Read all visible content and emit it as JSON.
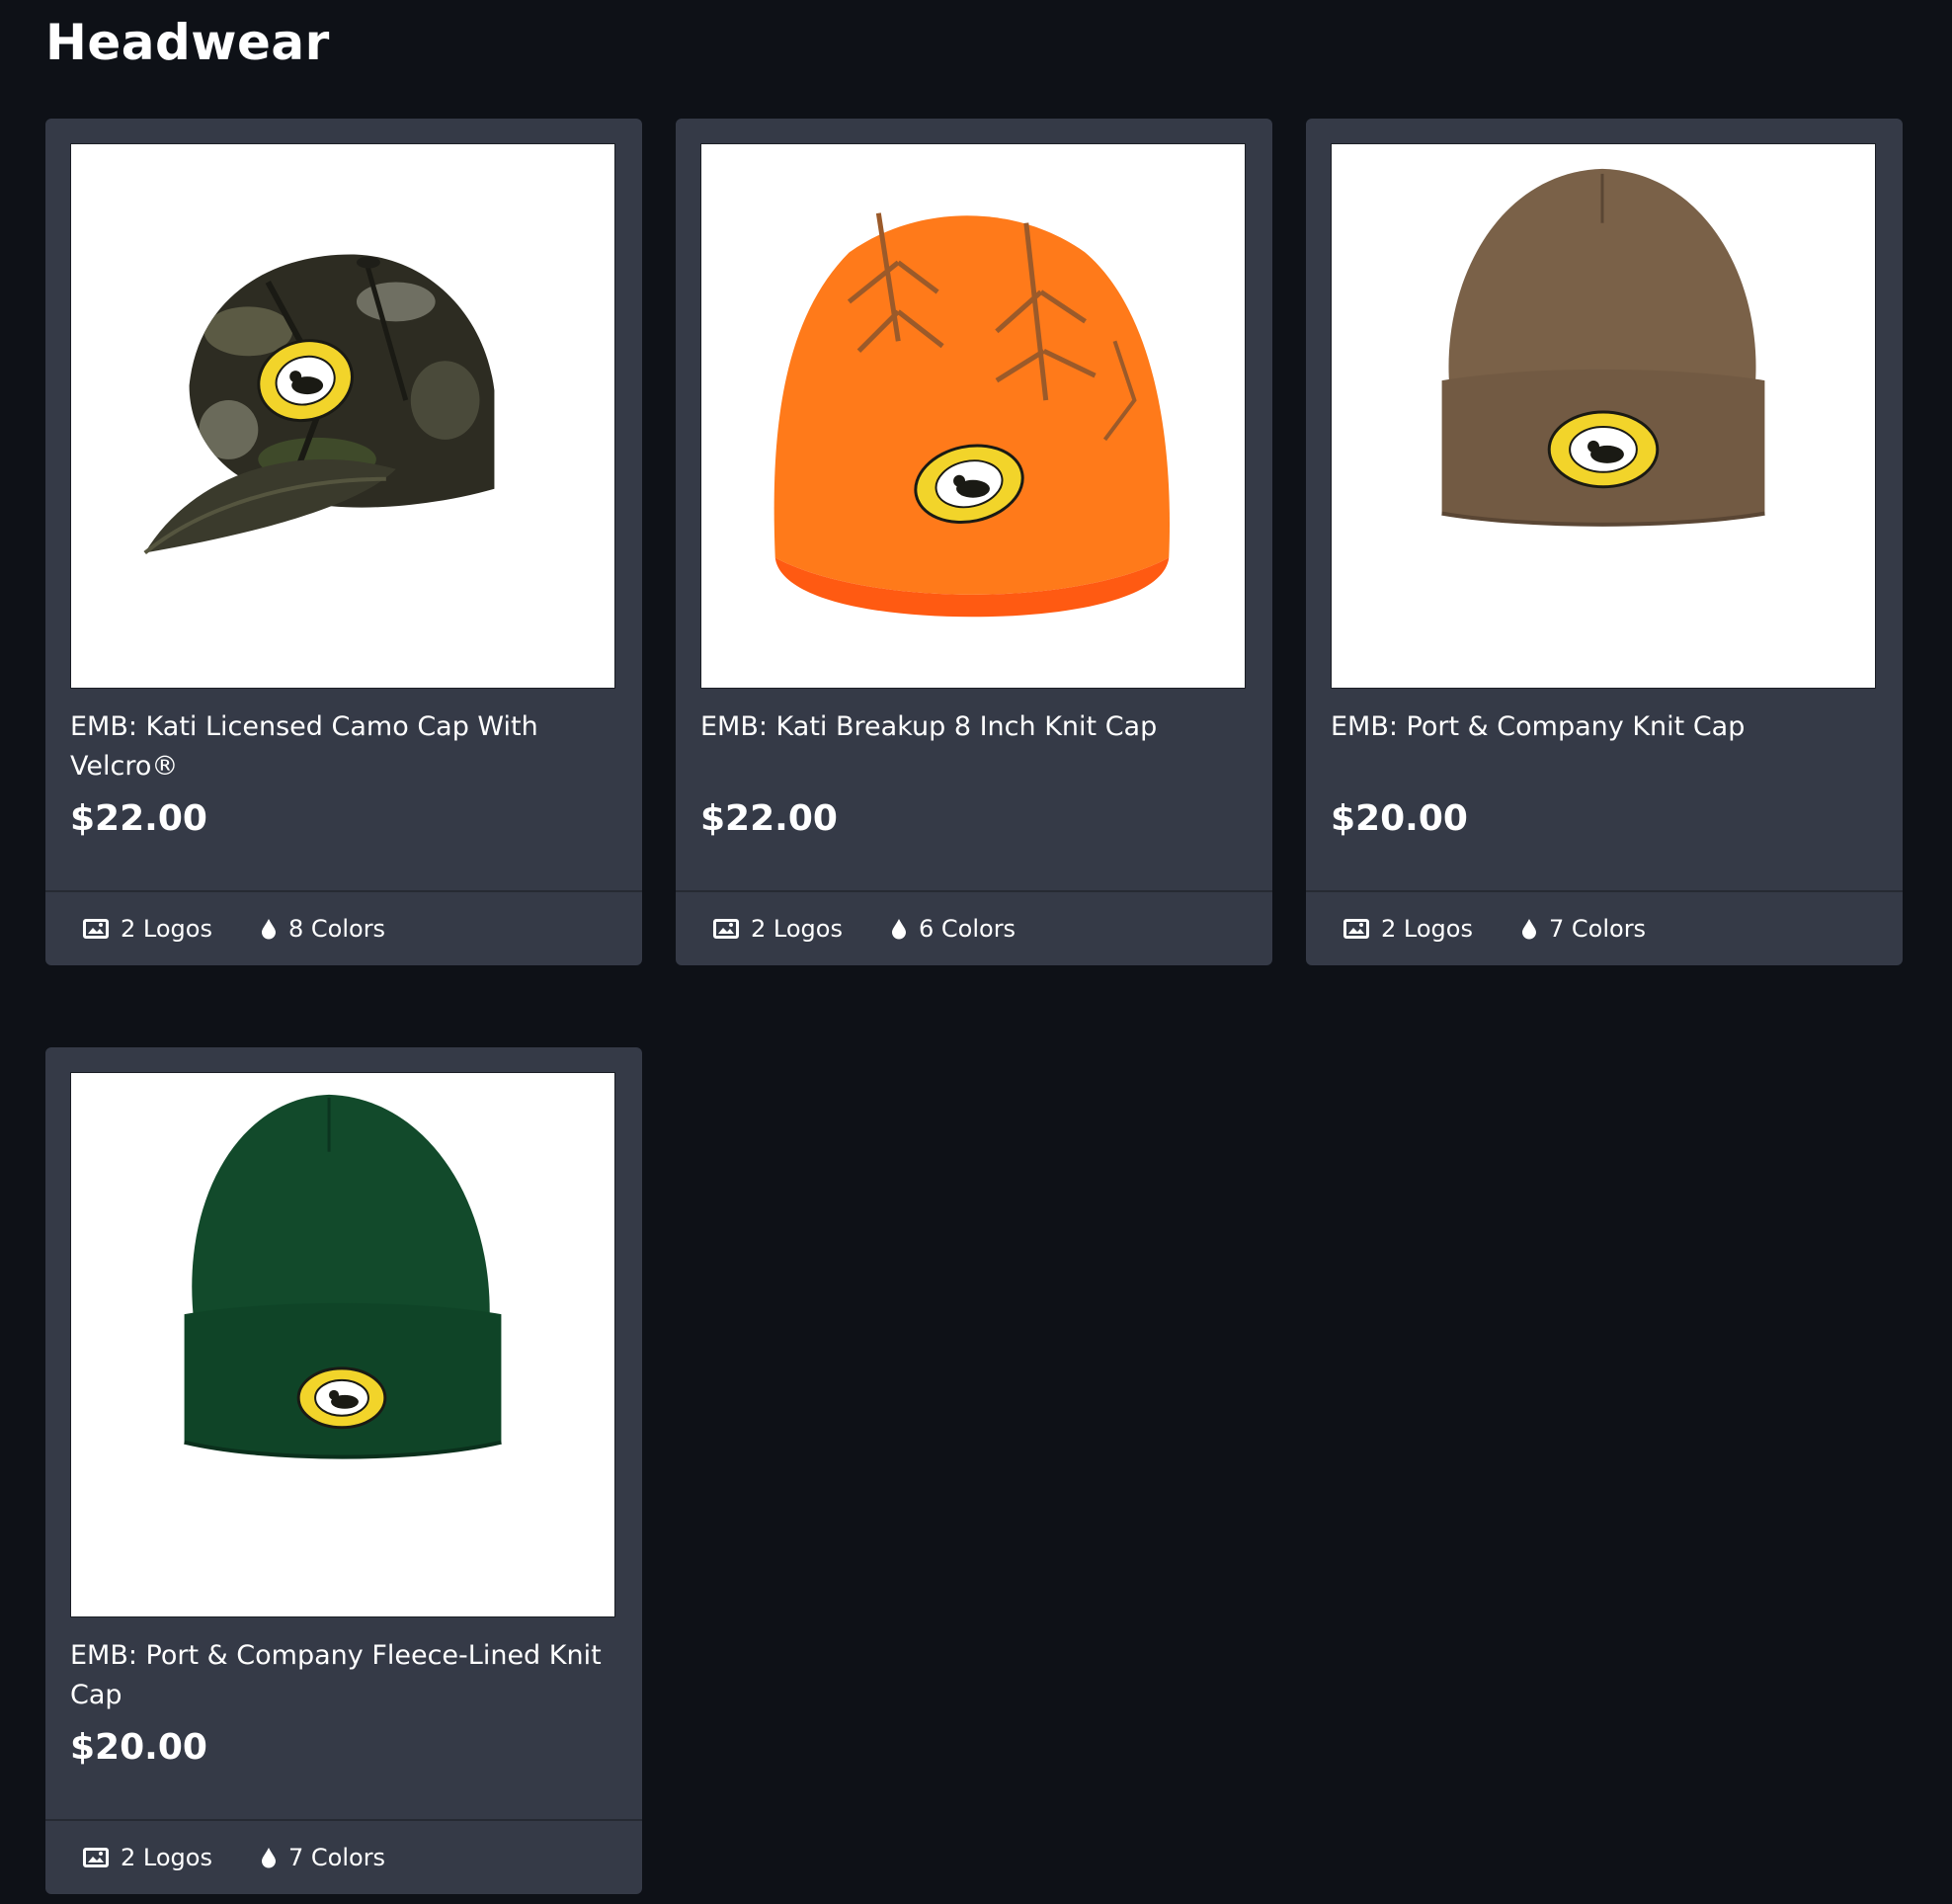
{
  "page": {
    "title": "Headwear",
    "background": "#0e1117",
    "card_background": "#353a47"
  },
  "products": [
    {
      "name": "EMB: Kati Licensed Camo Cap With Velcro®",
      "price": "$22.00",
      "logos": "2 Logos",
      "colors": "8 Colors",
      "product_color": "#3b3a2c"
    },
    {
      "name": "EMB: Kati Breakup 8 Inch Knit Cap",
      "price": "$22.00",
      "logos": "2 Logos",
      "colors": "6 Colors",
      "product_color": "#ff7a1a"
    },
    {
      "name": "EMB: Port & Company Knit Cap",
      "price": "$20.00",
      "logos": "2 Logos",
      "colors": "7 Colors",
      "product_color": "#7a6148"
    },
    {
      "name": "EMB: Port & Company Fleece-Lined Knit Cap",
      "price": "$20.00",
      "logos": "2 Logos",
      "colors": "7 Colors",
      "product_color": "#124a2b"
    }
  ],
  "icons": {
    "logos": "image-icon",
    "colors": "droplet-icon"
  }
}
